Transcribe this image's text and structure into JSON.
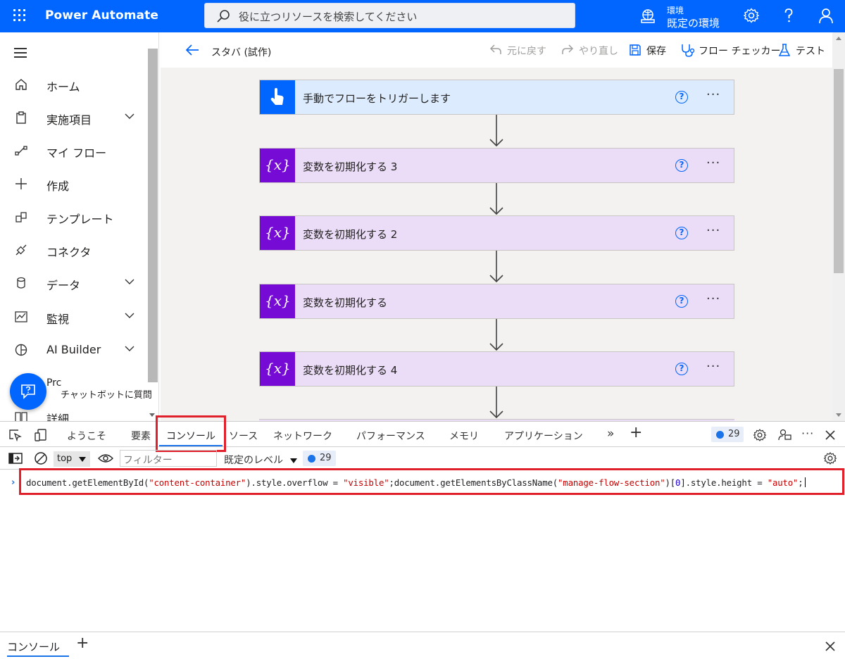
{
  "topbar": {
    "brand": "Power Automate",
    "search_placeholder": "役に立つリソースを検索してください",
    "env_label": "環境",
    "env_value": "既定の環境",
    "icons": [
      "waffle-icon",
      "search-icon",
      "environment-icon",
      "settings-icon",
      "help-icon",
      "profile-icon"
    ]
  },
  "sidebar": {
    "items": [
      {
        "label": "ホーム",
        "icon": "home-icon",
        "chevron": false
      },
      {
        "label": "実施項目",
        "icon": "clipboard-icon",
        "chevron": true
      },
      {
        "label": "マイ フロー",
        "icon": "flow-icon",
        "chevron": false
      },
      {
        "label": "作成",
        "icon": "plus-icon",
        "chevron": false
      },
      {
        "label": "テンプレート",
        "icon": "template-icon",
        "chevron": false
      },
      {
        "label": "コネクタ",
        "icon": "connector-icon",
        "chevron": false
      },
      {
        "label": "データ",
        "icon": "database-icon",
        "chevron": true
      },
      {
        "label": "監視",
        "icon": "monitor-icon",
        "chevron": true
      },
      {
        "label": "AI Builder",
        "icon": "ai-builder-icon",
        "chevron": true
      },
      {
        "label": "Prc",
        "icon": "process-icon",
        "chevron": false
      },
      {
        "label": "詳細",
        "icon": "book-icon",
        "chevron": false
      }
    ],
    "chatbot_label": "チャットボットに質問"
  },
  "editor": {
    "flow_title": "スタバ (試作)",
    "commands": {
      "undo": "元に戻す",
      "redo": "やり直し",
      "save": "保存",
      "checker": "フロー チェッカー",
      "test": "テスト"
    },
    "steps": [
      {
        "name": "手動でフローをトリガーします",
        "kind": "trigger"
      },
      {
        "name": "変数を初期化する 3",
        "kind": "variable"
      },
      {
        "name": "変数を初期化する 2",
        "kind": "variable"
      },
      {
        "name": "変数を初期化する",
        "kind": "variable"
      },
      {
        "name": "変数を初期化する 4",
        "kind": "variable"
      }
    ],
    "help_glyph": "?",
    "more_glyph": "···",
    "variable_glyph": "{x}"
  },
  "devtools": {
    "tabs": [
      "ようこそ",
      "要素",
      "コンソール",
      "ソース",
      "ネットワーク",
      "パフォーマンス",
      "メモリ",
      "アプリケーション"
    ],
    "active_tab": "コンソール",
    "more_tabs": "»",
    "add_tab": "+",
    "issues_count": "29",
    "context": "top",
    "filter_placeholder": "フィルター",
    "level": "既定のレベル",
    "console_count": "29",
    "command": {
      "p1": "document.getElementById(",
      "s1": "\"content-container\"",
      "p2": ").style.overflow = ",
      "s2": "\"visible\"",
      "p3": ";document.getElementsByClassName(",
      "s3": "\"manage-flow-section\"",
      "p4": ")[",
      "n1": "0",
      "p5": "].style.height = ",
      "s4": "\"auto\"",
      "p6": ";"
    },
    "drawer_tab": "コンソール",
    "drawer_add": "+"
  },
  "colors": {
    "brand": "#0066ff",
    "variable": "#770bd6",
    "highlight": "#e0202a"
  }
}
